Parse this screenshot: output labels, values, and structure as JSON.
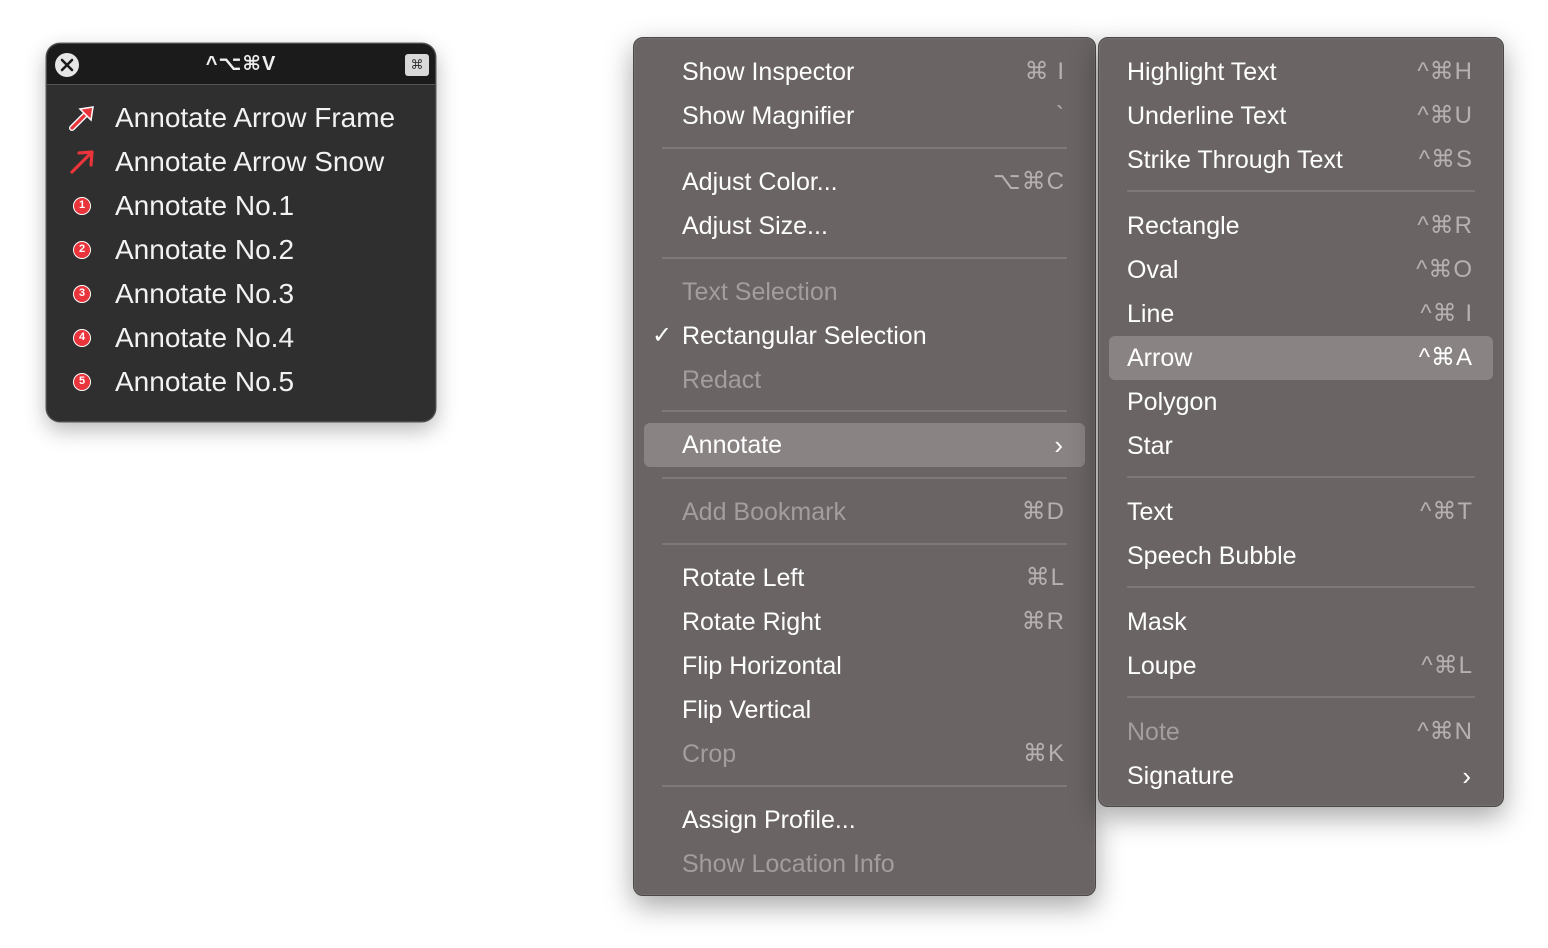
{
  "palette": {
    "title": "^⌥⌘V",
    "gear_glyph": "⌘",
    "items": [
      {
        "label": "Annotate Arrow Frame",
        "icon": "red-arrow-icon"
      },
      {
        "label": "Annotate Arrow Snow",
        "icon": "red-arrow-icon"
      },
      {
        "label": "Annotate No.1",
        "badge": "1"
      },
      {
        "label": "Annotate No.2",
        "badge": "2"
      },
      {
        "label": "Annotate No.3",
        "badge": "3"
      },
      {
        "label": "Annotate No.4",
        "badge": "4"
      },
      {
        "label": "Annotate No.5",
        "badge": "5"
      }
    ]
  },
  "main_menu": {
    "items": [
      {
        "label": "Show Inspector",
        "shortcut": "⌘ I"
      },
      {
        "label": "Show Magnifier",
        "shortcut": "`"
      },
      {
        "label": "Adjust Color...",
        "shortcut": "⌥⌘C"
      },
      {
        "label": "Adjust Size..."
      },
      {
        "label": "Text Selection",
        "disabled": true
      },
      {
        "label": "Rectangular Selection",
        "checked": true
      },
      {
        "label": "Redact",
        "disabled": true
      },
      {
        "label": "Annotate",
        "submenu": true,
        "highlighted": true
      },
      {
        "label": "Add Bookmark",
        "shortcut": "⌘D",
        "disabled": true
      },
      {
        "label": "Rotate Left",
        "shortcut": "⌘L"
      },
      {
        "label": "Rotate Right",
        "shortcut": "⌘R"
      },
      {
        "label": "Flip Horizontal"
      },
      {
        "label": "Flip Vertical"
      },
      {
        "label": "Crop",
        "shortcut": "⌘K",
        "disabled": true
      },
      {
        "label": "Assign Profile..."
      },
      {
        "label": "Show Location Info",
        "disabled": true
      }
    ],
    "check_glyph": "✓",
    "chevron_glyph": "›"
  },
  "sub_menu": {
    "items": [
      {
        "label": "Highlight Text",
        "shortcut": "^⌘H"
      },
      {
        "label": "Underline Text",
        "shortcut": "^⌘U"
      },
      {
        "label": "Strike Through Text",
        "shortcut": "^⌘S"
      },
      {
        "label": "Rectangle",
        "shortcut": "^⌘R"
      },
      {
        "label": "Oval",
        "shortcut": "^⌘O"
      },
      {
        "label": "Line",
        "shortcut": "^⌘ I"
      },
      {
        "label": "Arrow",
        "shortcut": "^⌘A",
        "highlighted": true
      },
      {
        "label": "Polygon"
      },
      {
        "label": "Star"
      },
      {
        "label": "Text",
        "shortcut": "^⌘T"
      },
      {
        "label": "Speech Bubble"
      },
      {
        "label": "Mask"
      },
      {
        "label": "Loupe",
        "shortcut": "^⌘L"
      },
      {
        "label": "Note",
        "shortcut": "^⌘N",
        "disabled": true
      },
      {
        "label": "Signature",
        "submenu": true
      }
    ],
    "chevron_glyph": "›"
  },
  "colors": {
    "menu_bg": "#6a6464",
    "highlight_bg": "#8a8383",
    "palette_bg": "#2f2f2f",
    "badge_red": "#e8343a"
  }
}
